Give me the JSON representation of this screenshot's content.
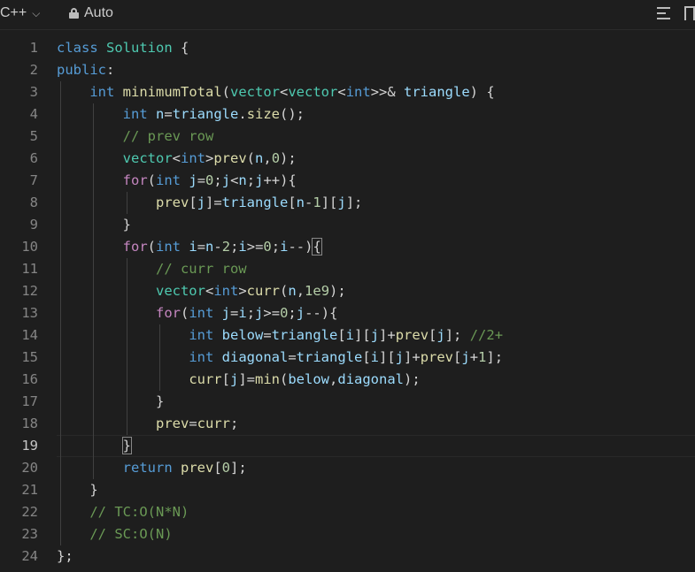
{
  "toolbar": {
    "language": "C++",
    "mode": "Auto",
    "icons": [
      "chevron-down-icon",
      "lock-icon",
      "list-icon",
      "bookmark-icon"
    ]
  },
  "editor": {
    "active_line": 19,
    "lines": [
      {
        "n": "1",
        "code": "class Solution {"
      },
      {
        "n": "2",
        "code": "public:"
      },
      {
        "n": "3",
        "code": "    int minimumTotal(vector<vector<int>>& triangle) {"
      },
      {
        "n": "4",
        "code": "        int n=triangle.size();"
      },
      {
        "n": "5",
        "code": "        // prev row"
      },
      {
        "n": "6",
        "code": "        vector<int>prev(n,0);"
      },
      {
        "n": "7",
        "code": "        for(int j=0;j<n;j++){"
      },
      {
        "n": "8",
        "code": "            prev[j]=triangle[n-1][j];"
      },
      {
        "n": "9",
        "code": "        }"
      },
      {
        "n": "10",
        "code": "        for(int i=n-2;i>=0;i--){"
      },
      {
        "n": "11",
        "code": "            // curr row"
      },
      {
        "n": "12",
        "code": "            vector<int>curr(n,1e9);"
      },
      {
        "n": "13",
        "code": "            for(int j=i;j>=0;j--){"
      },
      {
        "n": "14",
        "code": "                int below=triangle[i][j]+prev[j]; //2+"
      },
      {
        "n": "15",
        "code": "                int diagonal=triangle[i][j]+prev[j+1];"
      },
      {
        "n": "16",
        "code": "                curr[j]=min(below,diagonal);"
      },
      {
        "n": "17",
        "code": "            }"
      },
      {
        "n": "18",
        "code": "            prev=curr;"
      },
      {
        "n": "19",
        "code": "        }"
      },
      {
        "n": "20",
        "code": "        return prev[0];"
      },
      {
        "n": "21",
        "code": "    }"
      },
      {
        "n": "22",
        "code": "    // TC:O(N*N)"
      },
      {
        "n": "23",
        "code": "    // SC:O(N)"
      },
      {
        "n": "24",
        "code": "};"
      }
    ]
  }
}
